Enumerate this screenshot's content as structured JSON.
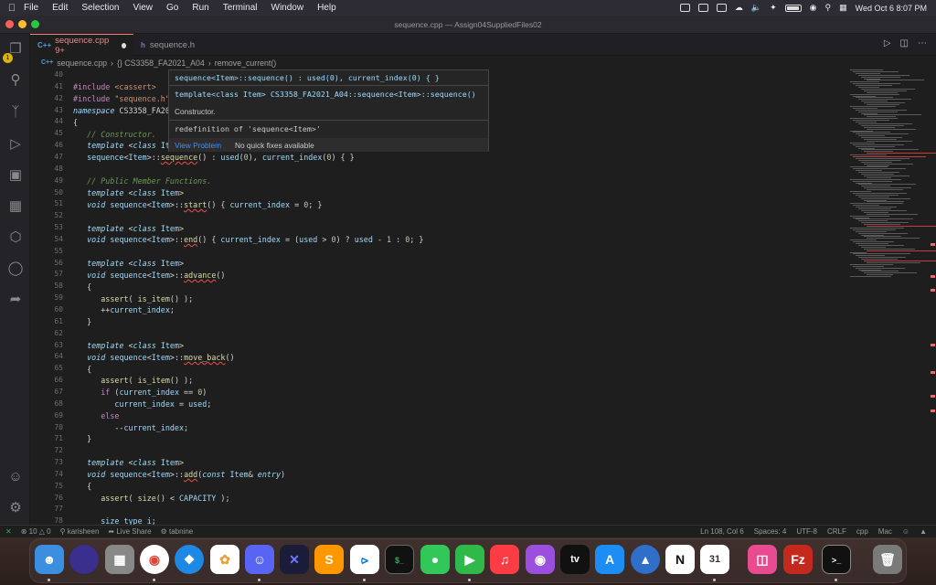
{
  "menubar": {
    "app_name": "Code",
    "menus": [
      "File",
      "Edit",
      "Selection",
      "View",
      "Go",
      "Run",
      "Terminal",
      "Window",
      "Help"
    ],
    "clock": "Wed Oct 6  8:07 PM"
  },
  "window": {
    "title": "sequence.cpp — Assign04SuppliedFiles02"
  },
  "tabs": [
    {
      "label": "sequence.cpp 9+",
      "icon": "C++",
      "modified": true
    },
    {
      "label": "sequence.h",
      "icon": "h"
    }
  ],
  "breadcrumb": [
    "sequence.cpp",
    "{} CS3358_FA2021_A04",
    "remove_current()"
  ],
  "editor": {
    "lines": [
      40,
      41,
      42,
      43,
      44,
      45,
      46,
      47,
      48,
      49,
      50,
      51,
      52,
      53,
      54,
      55,
      56,
      57,
      58,
      59,
      60,
      61,
      62,
      63,
      64,
      65,
      66,
      67,
      68,
      69,
      70,
      71,
      72,
      73,
      74,
      75,
      76,
      77,
      78
    ]
  },
  "hover": {
    "signature": "sequence<Item>::sequence() : used(0), current_index(0) { }",
    "declaration": "template<class Item> CS3358_FA2021_A04::sequence<Item>::sequence()",
    "doc": "Constructor.",
    "problem": "redefinition of 'sequence<Item>'",
    "view_problem": "View Problem",
    "no_fixes": "No quick fixes available"
  },
  "status": {
    "errors": "10",
    "warnings": "0",
    "user": "karisheen",
    "live_share": "Live Share",
    "tabnine": "tabnine",
    "position": "Ln 108, Col 6",
    "spaces": "Spaces: 4",
    "encoding": "UTF-8",
    "eol": "CRLF",
    "language": "cpp",
    "platform": "Mac"
  },
  "dock": [
    "Finder",
    "Siri",
    "Launchpad",
    "Chrome",
    "Safari",
    "Photos",
    "Discord",
    "Codeium",
    "Sublime",
    "VS Code",
    "Terminal-like",
    "Messages",
    "FaceTime",
    "Music",
    "Podcasts",
    "TV",
    "App Store",
    "Proton",
    "Notion",
    "Calendar",
    "Preview",
    "FileZilla",
    "Terminal",
    "Trash"
  ]
}
